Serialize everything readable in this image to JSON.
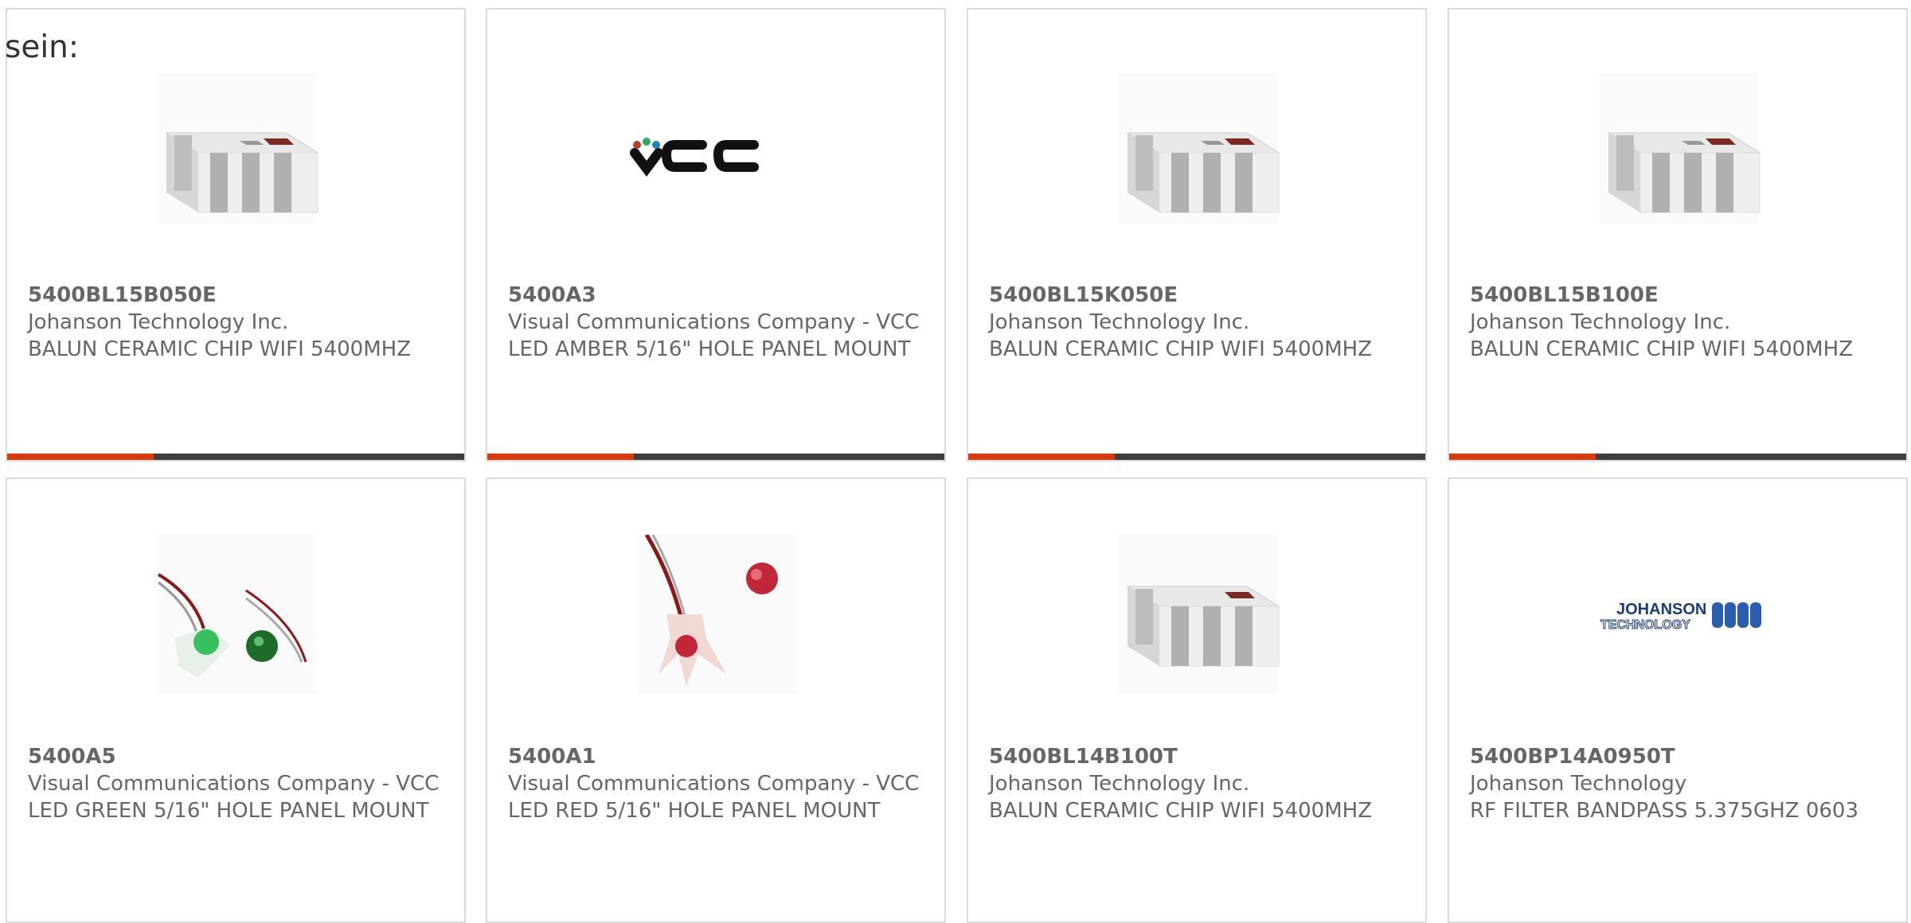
{
  "intro_text": "sein:",
  "accent_color": "#d83b10",
  "bar_color": "#3f3f3f",
  "products": [
    {
      "part_number": "5400BL15B050E",
      "manufacturer": "Johanson Technology Inc.",
      "description": "BALUN CERAMIC CHIP WIFI 5400MHZ",
      "image": "ceramic-chip-balun-image"
    },
    {
      "part_number": "5400A3",
      "manufacturer": "Visual Communications Company - VCC",
      "description": "LED AMBER 5/16\" HOLE PANEL MOUNT",
      "image": "vcc-logo",
      "logo_text": "VCC"
    },
    {
      "part_number": "5400BL15K050E",
      "manufacturer": "Johanson Technology Inc.",
      "description": "BALUN CERAMIC CHIP WIFI 5400MHZ",
      "image": "ceramic-chip-balun-image"
    },
    {
      "part_number": "5400BL15B100E",
      "manufacturer": "Johanson Technology Inc.",
      "description": "BALUN CERAMIC CHIP WIFI 5400MHZ",
      "image": "ceramic-chip-balun-image"
    },
    {
      "part_number": "5400A5",
      "manufacturer": "Visual Communications Company - VCC",
      "description": "LED GREEN 5/16\" HOLE PANEL MOUNT",
      "image": "green-led-image"
    },
    {
      "part_number": "5400A1",
      "manufacturer": "Visual Communications Company - VCC",
      "description": "LED RED 5/16\" HOLE PANEL MOUNT",
      "image": "red-led-image"
    },
    {
      "part_number": "5400BL14B100T",
      "manufacturer": "Johanson Technology Inc.",
      "description": "BALUN CERAMIC CHIP WIFI 5400MHZ",
      "image": "ceramic-chip-balun-image"
    },
    {
      "part_number": "5400BP14A0950T",
      "manufacturer": "Johanson Technology",
      "description": "RF FILTER BANDPASS 5.375GHZ 0603",
      "image": "johanson-technology-logo",
      "logo_text": "JOHANSON TECHNOLOGY"
    }
  ]
}
